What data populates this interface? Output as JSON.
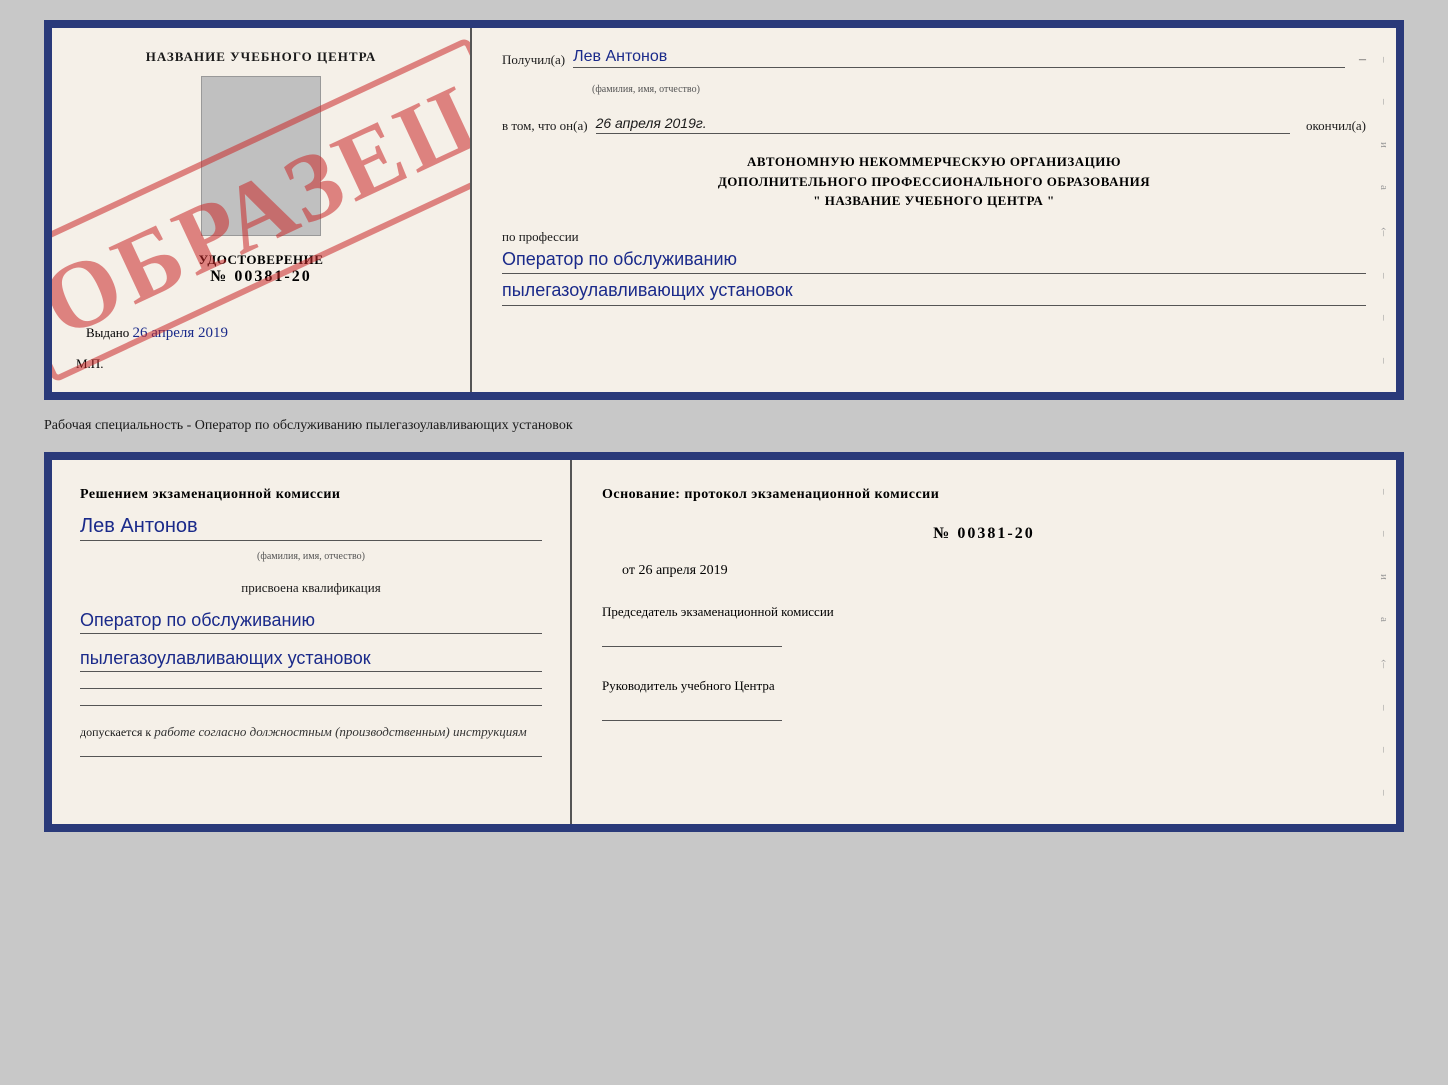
{
  "page": {
    "background": "#c8c8c8"
  },
  "separator": {
    "text": "Рабочая специальность - Оператор по обслуживанию пылегазоулавливающих установок"
  },
  "cert_top": {
    "left": {
      "title": "НАЗВАНИЕ УЧЕБНОГО ЦЕНТРА",
      "watermark": "ОБРАЗЕЦ",
      "udostoverenie_label": "УДОСТОВЕРЕНИЕ",
      "number": "№ 00381-20",
      "issued_label": "Выдано",
      "issued_date": "26 апреля 2019",
      "mp": "М.П."
    },
    "right": {
      "received_label": "Получил(а)",
      "recipient_name": "Лев Антонов",
      "recipient_subtext": "(фамилия, имя, отчество)",
      "date_label": "в том, что он(а)",
      "date_value": "26 апреля 2019г.",
      "finished_label": "окончил(а)",
      "org_line1": "АВТОНОМНУЮ НЕКОММЕРЧЕСКУЮ ОРГАНИЗАЦИЮ",
      "org_line2": "ДОПОЛНИТЕЛЬНОГО ПРОФЕССИОНАЛЬНОГО ОБРАЗОВАНИЯ",
      "org_line3": "\" НАЗВАНИЕ УЧЕБНОГО ЦЕНТРА \"",
      "profession_label": "по профессии",
      "profession_line1": "Оператор по обслуживанию",
      "profession_line2": "пылегазоулавливающих установок"
    }
  },
  "cert_bottom": {
    "left": {
      "decision_text": "Решением экзаменационной комиссии",
      "name": "Лев Антонов",
      "name_subtext": "(фамилия, имя, отчество)",
      "assigned_label": "присвоена квалификация",
      "qual_line1": "Оператор по обслуживанию",
      "qual_line2": "пылегазоулавливающих установок",
      "allowed_label": "допускается к",
      "allowed_text": "работе согласно должностным (производственным) инструкциям"
    },
    "right": {
      "basis_label": "Основание: протокол экзаменационной комиссии",
      "protocol_number": "№ 00381-20",
      "date_prefix": "от",
      "date_value": "26 апреля 2019",
      "chairman_label": "Председатель экзаменационной комиссии",
      "head_label": "Руководитель учебного Центра"
    }
  }
}
